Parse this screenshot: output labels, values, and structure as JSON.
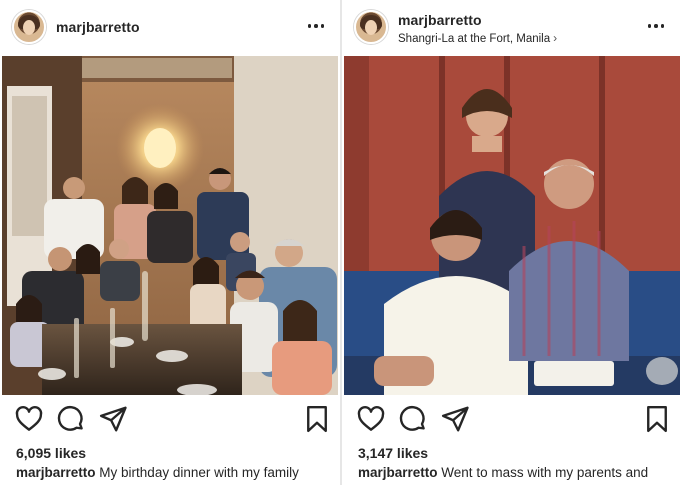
{
  "posts": [
    {
      "username": "marjbarretto",
      "location": "",
      "likes": "6,095 likes",
      "caption_user": "marjbarretto",
      "caption_text": "My birthday dinner with my family",
      "icons": [
        "heart-icon",
        "comment-icon",
        "share-icon",
        "bookmark-icon",
        "more-icon"
      ]
    },
    {
      "username": "marjbarretto",
      "location": "Shangri-La at the Fort, Manila",
      "location_chevron": "›",
      "likes": "3,147 likes",
      "caption_user": "marjbarretto",
      "caption_text": "Went to mass with my parents and",
      "icons": [
        "heart-icon",
        "comment-icon",
        "share-icon",
        "bookmark-icon",
        "more-icon"
      ]
    }
  ],
  "colors": {
    "text": "#262626",
    "divider": "#e6e6e6",
    "background": "#ffffff"
  }
}
